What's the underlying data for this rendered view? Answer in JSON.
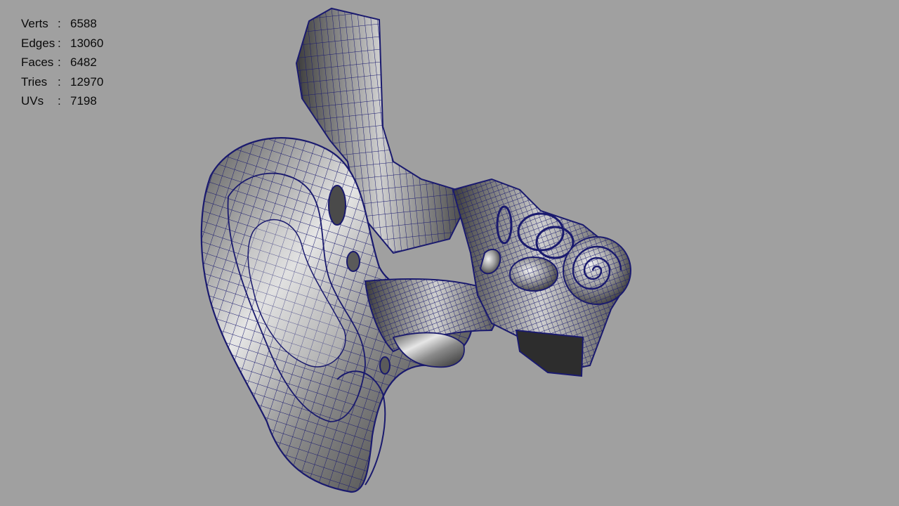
{
  "stats": [
    {
      "label": "Verts",
      "sep": ":",
      "value": "6588"
    },
    {
      "label": "Edges",
      "sep": ":",
      "value": "13060"
    },
    {
      "label": "Faces",
      "sep": ":",
      "value": "6482"
    },
    {
      "label": "Tries",
      "sep": ":",
      "value": "12970"
    },
    {
      "label": "UVs",
      "sep": ":",
      "value": "7198"
    }
  ],
  "colors": {
    "background": "#a0a0a0",
    "wire": "#1a1a6e",
    "shade_light": "#e8e8e8",
    "shade_dark": "#3a3a3a"
  }
}
